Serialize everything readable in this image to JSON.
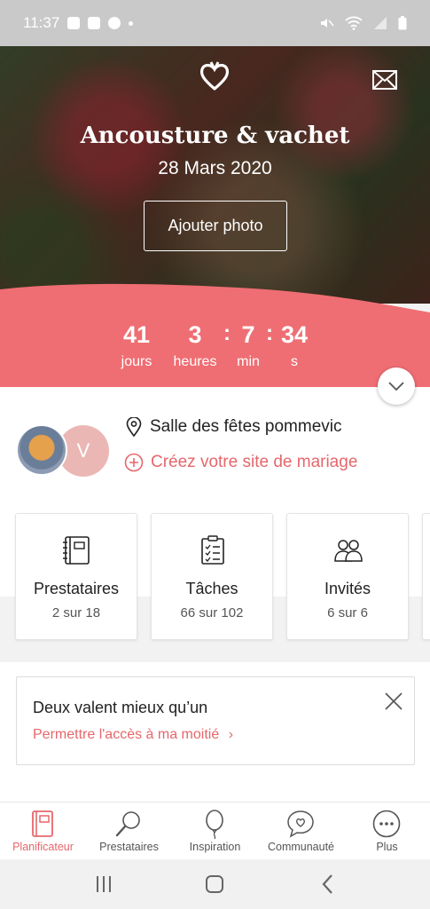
{
  "status_bar": {
    "time": "11:37"
  },
  "hero": {
    "couple_name": "Ancousture & vachet",
    "date": "28 Mars 2020",
    "add_photo_label": "Ajouter photo",
    "logo_icon": "heart-logo-icon",
    "mail_icon": "mail-icon"
  },
  "countdown": {
    "days": "41",
    "days_label": "jours",
    "hours": "3",
    "hours_label": "heures",
    "minutes": "7",
    "minutes_label": "min",
    "seconds": "34",
    "seconds_label": "s",
    "separator": ":"
  },
  "profile": {
    "avatar_initial": "V",
    "venue": "Salle des fêtes pommevic",
    "site_link": "Créez votre site de mariage"
  },
  "cards": [
    {
      "title": "Prestataires",
      "subtitle": "2 sur 18",
      "icon": "notebook-icon"
    },
    {
      "title": "Tâches",
      "subtitle": "66 sur 102",
      "icon": "checklist-icon"
    },
    {
      "title": "Invités",
      "subtitle": "6 sur 6",
      "icon": "guests-icon"
    }
  ],
  "promo": {
    "title": "Deux valent mieux qu’un",
    "link": "Permettre l'accès à ma moitié",
    "link_arrow": "›"
  },
  "bottom_nav": [
    {
      "label": "Planificateur",
      "icon": "planner-icon",
      "active": true
    },
    {
      "label": "Prestataires",
      "icon": "magnifier-icon",
      "active": false
    },
    {
      "label": "Inspiration",
      "icon": "balloon-icon",
      "active": false
    },
    {
      "label": "Communauté",
      "icon": "chat-heart-icon",
      "active": false
    },
    {
      "label": "Plus",
      "icon": "more-icon",
      "active": false
    }
  ],
  "colors": {
    "accent": "#e5676c",
    "countdown_bg": "#ef6e73",
    "avatar_bg": "#ebb7b5"
  }
}
